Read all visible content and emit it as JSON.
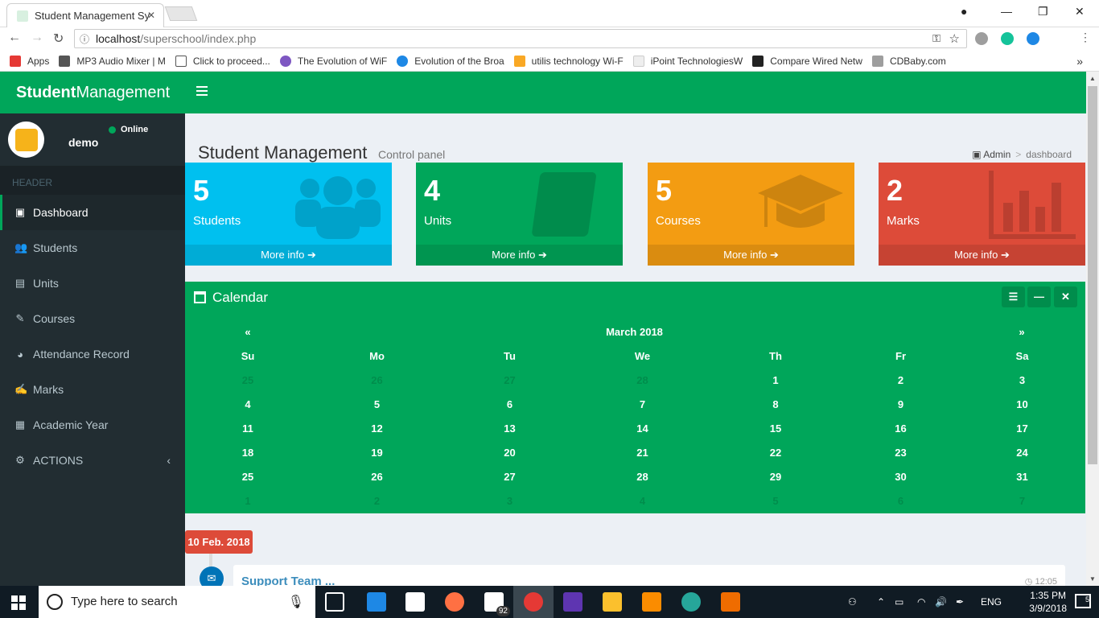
{
  "browser": {
    "tab_title": "Student Management Sy",
    "url_host": "localhost",
    "url_path": "/superschool/index.php",
    "bookmarks": [
      {
        "label": "Apps",
        "icon": "apps-grid-icon",
        "color": "#e53935"
      },
      {
        "label": "MP3 Audio Mixer | M",
        "icon": "audio-mixer-icon",
        "color": "#555555"
      },
      {
        "label": "Click to proceed...",
        "icon": "page-icon",
        "color": "#ffffff"
      },
      {
        "label": "The Evolution of WiF",
        "icon": "wifi-icon",
        "color": "#7e57c2"
      },
      {
        "label": "Evolution of the Broa",
        "icon": "broadband-icon",
        "color": "#1e88e5"
      },
      {
        "label": "utilis technology Wi-F",
        "icon": "utilis-icon",
        "color": "#f9a825"
      },
      {
        "label": "iPoint TechnologiesW",
        "icon": "ipoint-icon",
        "color": "#eeeeee"
      },
      {
        "label": "Compare Wired Netw",
        "icon": "g-icon",
        "color": "#222222"
      },
      {
        "label": "CDBaby.com",
        "icon": "cdbaby-icon",
        "color": "#9e9e9e"
      }
    ]
  },
  "sidebar": {
    "brand_bold": "Student",
    "brand_rest": "Management",
    "user_name": "demo",
    "user_status": "Online",
    "header_label": "HEADER",
    "items": [
      {
        "label": "Dashboard",
        "icon": "dashboard-icon",
        "glyph": "▣",
        "active": true
      },
      {
        "label": "Students",
        "icon": "users-icon",
        "glyph": "👥"
      },
      {
        "label": "Units",
        "icon": "book-icon",
        "glyph": "▤"
      },
      {
        "label": "Courses",
        "icon": "pencil-icon",
        "glyph": "✎"
      },
      {
        "label": "Attendance Record",
        "icon": "pie-chart-icon",
        "glyph": "◕"
      },
      {
        "label": "Marks",
        "icon": "edit-icon",
        "glyph": "✍"
      },
      {
        "label": "Academic Year",
        "icon": "calendar-icon",
        "glyph": "▦"
      },
      {
        "label": "ACTIONS",
        "icon": "cogs-icon",
        "glyph": "⚙",
        "chevron": "‹"
      }
    ]
  },
  "page": {
    "title": "Student Management",
    "subtitle": "Control panel",
    "breadcrumb_home": "Admin",
    "breadcrumb_current": "dashboard"
  },
  "stats": [
    {
      "value": "5",
      "label": "Students",
      "more": "More info",
      "color": "#00c0ef",
      "icon": "users-icon"
    },
    {
      "value": "4",
      "label": "Units",
      "more": "More info",
      "color": "#00a65a",
      "icon": "book-icon"
    },
    {
      "value": "5",
      "label": "Courses",
      "more": "More info",
      "color": "#f39c12",
      "icon": "graduation-cap-icon"
    },
    {
      "value": "2",
      "label": "Marks",
      "more": "More info",
      "color": "#dd4b39",
      "icon": "bar-chart-icon"
    }
  ],
  "calendar": {
    "title": "Calendar",
    "month": "March 2018",
    "prev": "«",
    "next": "»",
    "days": [
      "Su",
      "Mo",
      "Tu",
      "We",
      "Th",
      "Fr",
      "Sa"
    ],
    "weeks": [
      [
        {
          "d": "25",
          "m": true
        },
        {
          "d": "26",
          "m": true
        },
        {
          "d": "27",
          "m": true
        },
        {
          "d": "28",
          "m": true
        },
        {
          "d": "1"
        },
        {
          "d": "2"
        },
        {
          "d": "3"
        }
      ],
      [
        {
          "d": "4"
        },
        {
          "d": "5"
        },
        {
          "d": "6"
        },
        {
          "d": "7"
        },
        {
          "d": "8"
        },
        {
          "d": "9"
        },
        {
          "d": "10"
        }
      ],
      [
        {
          "d": "11"
        },
        {
          "d": "12"
        },
        {
          "d": "13"
        },
        {
          "d": "14"
        },
        {
          "d": "15"
        },
        {
          "d": "16"
        },
        {
          "d": "17"
        }
      ],
      [
        {
          "d": "18"
        },
        {
          "d": "19"
        },
        {
          "d": "20"
        },
        {
          "d": "21"
        },
        {
          "d": "22"
        },
        {
          "d": "23"
        },
        {
          "d": "24"
        }
      ],
      [
        {
          "d": "25"
        },
        {
          "d": "26"
        },
        {
          "d": "27"
        },
        {
          "d": "28"
        },
        {
          "d": "29"
        },
        {
          "d": "30"
        },
        {
          "d": "31"
        }
      ],
      [
        {
          "d": "1",
          "m": true
        },
        {
          "d": "2",
          "m": true
        },
        {
          "d": "3",
          "m": true
        },
        {
          "d": "4",
          "m": true
        },
        {
          "d": "5",
          "m": true
        },
        {
          "d": "6",
          "m": true
        },
        {
          "d": "7",
          "m": true
        }
      ]
    ]
  },
  "timeline": {
    "date": "10 Feb. 2018",
    "header": "Support Team ...",
    "time": "12:05"
  },
  "taskbar": {
    "search_placeholder": "Type here to search",
    "mail_badge": "92",
    "lang": "ENG",
    "time": "1:35 PM",
    "date": "3/9/2018",
    "notif_count": "5"
  }
}
